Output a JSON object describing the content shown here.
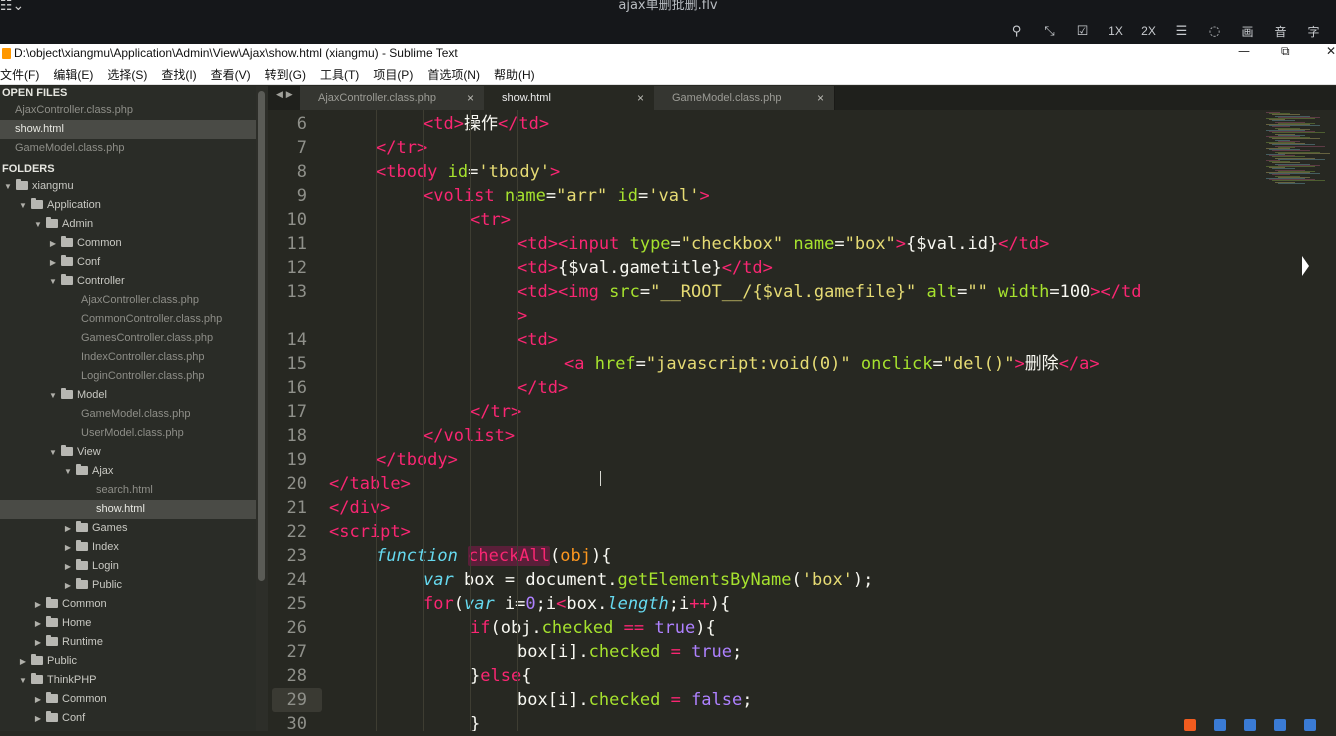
{
  "player": {
    "title": "ajax单删批删.flv",
    "menu_icon": "menu-icon",
    "controls": [
      {
        "icon": "pin-icon",
        "glyph": "⚲"
      },
      {
        "icon": "fullscreen-icon",
        "glyph": "⤡"
      },
      {
        "icon": "check-icon",
        "glyph": "☑"
      },
      {
        "text": "1X"
      },
      {
        "text": "2X"
      },
      {
        "icon": "list-icon",
        "glyph": "☰"
      },
      {
        "icon": "bulb-icon",
        "glyph": "◌"
      },
      {
        "text": "画"
      },
      {
        "text": "音"
      },
      {
        "text": "字"
      }
    ]
  },
  "window": {
    "title": "D:\\object\\xiangmu\\Application\\Admin\\View\\Ajax\\show.html (xiangmu) - Sublime Text"
  },
  "menu": [
    "文件(F)",
    "编辑(E)",
    "选择(S)",
    "查找(I)",
    "查看(V)",
    "转到(G)",
    "工具(T)",
    "项目(P)",
    "首选项(N)",
    "帮助(H)"
  ],
  "sidebar": {
    "open_files_label": "OPEN FILES",
    "folders_label": "FOLDERS",
    "open_files": [
      {
        "name": "AjaxController.class.php",
        "selected": false
      },
      {
        "name": "show.html",
        "selected": true
      },
      {
        "name": "GameModel.class.php",
        "selected": false
      }
    ],
    "tree": [
      {
        "name": "xiangmu",
        "depth": 0,
        "type": "folder",
        "open": true
      },
      {
        "name": "Application",
        "depth": 1,
        "type": "folder",
        "open": true
      },
      {
        "name": "Admin",
        "depth": 2,
        "type": "folder",
        "open": true
      },
      {
        "name": "Common",
        "depth": 3,
        "type": "folder",
        "open": false
      },
      {
        "name": "Conf",
        "depth": 3,
        "type": "folder",
        "open": false
      },
      {
        "name": "Controller",
        "depth": 3,
        "type": "folder",
        "open": true
      },
      {
        "name": "AjaxController.class.php",
        "depth": 4,
        "type": "file"
      },
      {
        "name": "CommonController.class.php",
        "depth": 4,
        "type": "file"
      },
      {
        "name": "GamesController.class.php",
        "depth": 4,
        "type": "file"
      },
      {
        "name": "IndexController.class.php",
        "depth": 4,
        "type": "file"
      },
      {
        "name": "LoginController.class.php",
        "depth": 4,
        "type": "file"
      },
      {
        "name": "Model",
        "depth": 3,
        "type": "folder",
        "open": true
      },
      {
        "name": "GameModel.class.php",
        "depth": 4,
        "type": "file"
      },
      {
        "name": "UserModel.class.php",
        "depth": 4,
        "type": "file"
      },
      {
        "name": "View",
        "depth": 3,
        "type": "folder",
        "open": true
      },
      {
        "name": "Ajax",
        "depth": 4,
        "type": "folder",
        "open": true
      },
      {
        "name": "search.html",
        "depth": 5,
        "type": "file"
      },
      {
        "name": "show.html",
        "depth": 5,
        "type": "file",
        "selected": true
      },
      {
        "name": "Games",
        "depth": 4,
        "type": "folder",
        "open": false
      },
      {
        "name": "Index",
        "depth": 4,
        "type": "folder",
        "open": false
      },
      {
        "name": "Login",
        "depth": 4,
        "type": "folder",
        "open": false
      },
      {
        "name": "Public",
        "depth": 4,
        "type": "folder",
        "open": false
      },
      {
        "name": "Common",
        "depth": 2,
        "type": "folder",
        "open": false
      },
      {
        "name": "Home",
        "depth": 2,
        "type": "folder",
        "open": false
      },
      {
        "name": "Runtime",
        "depth": 2,
        "type": "folder",
        "open": false
      },
      {
        "name": "Public",
        "depth": 1,
        "type": "folder",
        "open": false
      },
      {
        "name": "ThinkPHP",
        "depth": 1,
        "type": "folder",
        "open": true
      },
      {
        "name": "Common",
        "depth": 2,
        "type": "folder",
        "open": false
      },
      {
        "name": "Conf",
        "depth": 2,
        "type": "folder",
        "open": false
      }
    ]
  },
  "tabs": [
    {
      "name": "AjaxController.class.php",
      "active": false
    },
    {
      "name": "show.html",
      "active": true
    },
    {
      "name": "GameModel.class.php",
      "active": false
    }
  ],
  "tab_close": "×",
  "tab_nav": "◀ ▶",
  "editor": {
    "highlight_line": 29,
    "lines": [
      {
        "n": "6",
        "indent": 8,
        "tokens": [
          [
            "tag",
            "<td>"
          ],
          [
            "",
            "操作"
          ],
          [
            "tag",
            "</td>"
          ]
        ]
      },
      {
        "n": "7",
        "indent": 4,
        "tokens": [
          [
            "tag",
            "</tr>"
          ]
        ]
      },
      {
        "n": "8",
        "indent": 4,
        "tokens": [
          [
            "tag",
            "<tbody "
          ],
          [
            "attr",
            "id"
          ],
          [
            "",
            "="
          ],
          [
            "str",
            "'tbody'"
          ],
          [
            "tag",
            ">"
          ]
        ]
      },
      {
        "n": "9",
        "indent": 8,
        "tokens": [
          [
            "tag",
            "<volist "
          ],
          [
            "attr",
            "name"
          ],
          [
            "",
            "="
          ],
          [
            "str",
            "\"arr\""
          ],
          [
            "",
            " "
          ],
          [
            "attr",
            "id"
          ],
          [
            "",
            "="
          ],
          [
            "str",
            "'val'"
          ],
          [
            "tag",
            ">"
          ]
        ]
      },
      {
        "n": "10",
        "indent": 12,
        "tokens": [
          [
            "tag",
            "<tr>"
          ]
        ]
      },
      {
        "n": "11",
        "indent": 16,
        "tokens": [
          [
            "tag",
            "<td><input "
          ],
          [
            "attr",
            "type"
          ],
          [
            "",
            "="
          ],
          [
            "str",
            "\"checkbox\""
          ],
          [
            "",
            " "
          ],
          [
            "attr",
            "name"
          ],
          [
            "",
            "="
          ],
          [
            "str",
            "\"box\""
          ],
          [
            "tag",
            ">"
          ],
          [
            "",
            "{$val.id}"
          ],
          [
            "tag",
            "</td>"
          ]
        ]
      },
      {
        "n": "12",
        "indent": 16,
        "tokens": [
          [
            "tag",
            "<td>"
          ],
          [
            "",
            "{$val.gametitle}"
          ],
          [
            "tag",
            "</td>"
          ]
        ]
      },
      {
        "n": "13",
        "indent": 16,
        "tokens": [
          [
            "tag",
            "<td><img "
          ],
          [
            "attr",
            "src"
          ],
          [
            "",
            "="
          ],
          [
            "str",
            "\"__ROOT__/{$val.gamefile}\""
          ],
          [
            "",
            " "
          ],
          [
            "attr",
            "alt"
          ],
          [
            "",
            "="
          ],
          [
            "str",
            "\"\""
          ],
          [
            "",
            " "
          ],
          [
            "attr",
            "width"
          ],
          [
            "",
            "=100"
          ],
          [
            "tag",
            "></td"
          ]
        ]
      },
      {
        "n": "",
        "indent": 16,
        "tokens": [
          [
            "tag",
            ">"
          ]
        ]
      },
      {
        "n": "14",
        "indent": 16,
        "tokens": [
          [
            "tag",
            "<td>"
          ]
        ]
      },
      {
        "n": "15",
        "indent": 20,
        "tokens": [
          [
            "tag",
            "<a "
          ],
          [
            "attr",
            "href"
          ],
          [
            "",
            "="
          ],
          [
            "str",
            "\"javascript:void(0)\""
          ],
          [
            "",
            " "
          ],
          [
            "attr",
            "onclick"
          ],
          [
            "",
            "="
          ],
          [
            "str",
            "\"del()\""
          ],
          [
            "tag",
            ">"
          ],
          [
            "",
            "删除"
          ],
          [
            "tag",
            "</a>"
          ]
        ]
      },
      {
        "n": "16",
        "indent": 16,
        "tokens": [
          [
            "tag",
            "</td>"
          ]
        ]
      },
      {
        "n": "17",
        "indent": 12,
        "tokens": [
          [
            "tag",
            "</tr>"
          ]
        ]
      },
      {
        "n": "18",
        "indent": 8,
        "tokens": [
          [
            "tag",
            "</volist>"
          ]
        ]
      },
      {
        "n": "19",
        "indent": 4,
        "tokens": [
          [
            "tag",
            "</tbody>"
          ]
        ]
      },
      {
        "n": "20",
        "indent": 0,
        "tokens": [
          [
            "tag",
            "</table>"
          ]
        ]
      },
      {
        "n": "21",
        "indent": 0,
        "tokens": [
          [
            "tag",
            "</div>"
          ]
        ]
      },
      {
        "n": "22",
        "indent": 0,
        "tokens": [
          [
            "tag",
            "<script>"
          ]
        ]
      },
      {
        "n": "23",
        "indent": 4,
        "tokens": [
          [
            "storage",
            "function "
          ],
          [
            "hlfn",
            "checkAll"
          ],
          [
            "",
            "("
          ],
          [
            "param",
            "obj"
          ],
          [
            "",
            "){"
          ]
        ]
      },
      {
        "n": "24",
        "indent": 8,
        "tokens": [
          [
            "storage",
            "var "
          ],
          [
            "",
            "box = document."
          ],
          [
            "fn",
            "getElementsByName"
          ],
          [
            "",
            "("
          ],
          [
            "str",
            "'box'"
          ],
          [
            "",
            ");"
          ]
        ]
      },
      {
        "n": "25",
        "indent": 8,
        "tokens": [
          [
            "kw",
            "for"
          ],
          [
            "",
            "("
          ],
          [
            "storage",
            "var "
          ],
          [
            "",
            "i="
          ],
          [
            "const",
            "0"
          ],
          [
            "",
            ";i"
          ],
          [
            "kw",
            "<"
          ],
          [
            "",
            "box."
          ],
          [
            "storage",
            "length"
          ],
          [
            "",
            ";i"
          ],
          [
            "kw",
            "++"
          ],
          [
            "",
            "){"
          ]
        ]
      },
      {
        "n": "26",
        "indent": 12,
        "tokens": [
          [
            "kw",
            "if"
          ],
          [
            "",
            "(obj."
          ],
          [
            "fn",
            "checked"
          ],
          [
            "",
            " "
          ],
          [
            "kw",
            "=="
          ],
          [
            "",
            " "
          ],
          [
            "const",
            "true"
          ],
          [
            "",
            "){"
          ]
        ]
      },
      {
        "n": "27",
        "indent": 16,
        "tokens": [
          [
            "",
            "box[i]."
          ],
          [
            "fn",
            "checked"
          ],
          [
            "",
            " "
          ],
          [
            "kw",
            "="
          ],
          [
            "",
            " "
          ],
          [
            "const",
            "true"
          ],
          [
            "",
            ";"
          ]
        ]
      },
      {
        "n": "28",
        "indent": 12,
        "tokens": [
          [
            "",
            "}"
          ],
          [
            "kw",
            "else"
          ],
          [
            "",
            "{"
          ]
        ]
      },
      {
        "n": "29",
        "indent": 16,
        "tokens": [
          [
            "",
            "box[i]."
          ],
          [
            "fn",
            "checked"
          ],
          [
            "",
            " "
          ],
          [
            "kw",
            "="
          ],
          [
            "",
            " "
          ],
          [
            "const",
            "false"
          ],
          [
            "",
            ";"
          ]
        ]
      },
      {
        "n": "30",
        "indent": 12,
        "tokens": [
          [
            "",
            "}"
          ]
        ]
      }
    ]
  },
  "colors": {
    "bg": "#272822",
    "tag": "#f92672",
    "attr": "#a6e22e",
    "string": "#e6db74",
    "storage": "#66d9ef",
    "constant": "#ae81ff",
    "param": "#fd971f"
  }
}
